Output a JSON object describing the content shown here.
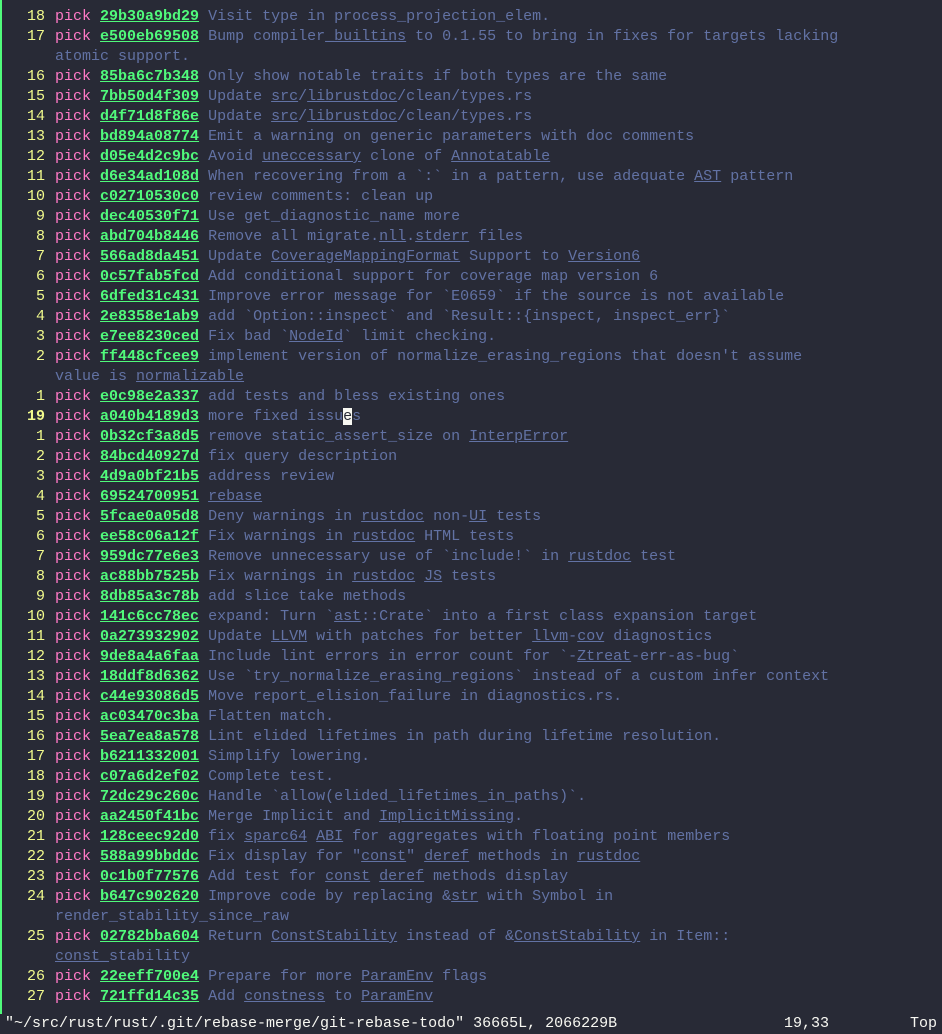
{
  "cursor_line_abs": "19",
  "lines": [
    {
      "ln": "18",
      "type": "commit",
      "hash": "29b30a9bd29",
      "msg_parts": [
        {
          "t": "Visit type in process_projection_elem."
        }
      ]
    },
    {
      "ln": "17",
      "type": "commit",
      "hash": "e500eb69508",
      "msg_parts": [
        {
          "t": "Bump compiler"
        },
        {
          "t": "_builtins",
          "u": 1
        },
        {
          "t": " to 0.1.55 to bring in fixes for targets lacking"
        }
      ]
    },
    {
      "ln": "",
      "type": "wrap",
      "msg_parts": [
        {
          "t": "atomic support."
        }
      ]
    },
    {
      "ln": "16",
      "type": "commit",
      "hash": "85ba6c7b348",
      "msg_parts": [
        {
          "t": "Only show notable traits if both types are the same"
        }
      ]
    },
    {
      "ln": "15",
      "type": "commit",
      "hash": "7bb50d4f309",
      "msg_parts": [
        {
          "t": "Update "
        },
        {
          "t": "src",
          "u": 1
        },
        {
          "t": "/"
        },
        {
          "t": "librustdoc",
          "u": 1
        },
        {
          "t": "/clean/types.rs"
        }
      ]
    },
    {
      "ln": "14",
      "type": "commit",
      "hash": "d4f71d8f86e",
      "msg_parts": [
        {
          "t": "Update "
        },
        {
          "t": "src",
          "u": 1
        },
        {
          "t": "/"
        },
        {
          "t": "librustdoc",
          "u": 1
        },
        {
          "t": "/clean/types.rs"
        }
      ]
    },
    {
      "ln": "13",
      "type": "commit",
      "hash": "bd894a08774",
      "msg_parts": [
        {
          "t": "Emit a warning on generic parameters with doc comments"
        }
      ]
    },
    {
      "ln": "12",
      "type": "commit",
      "hash": "d05e4d2c9bc",
      "msg_parts": [
        {
          "t": "Avoid "
        },
        {
          "t": "uneccessary",
          "u": 1
        },
        {
          "t": " clone of "
        },
        {
          "t": "Annotatable",
          "u": 1
        }
      ]
    },
    {
      "ln": "11",
      "type": "commit",
      "hash": "d6e34ad108d",
      "msg_parts": [
        {
          "t": "When recovering from a `:` in a pattern, use adequate "
        },
        {
          "t": "AST",
          "u": 1
        },
        {
          "t": " pattern"
        }
      ]
    },
    {
      "ln": "10",
      "type": "commit",
      "hash": "c02710530c0",
      "msg_parts": [
        {
          "t": "review comments: clean up"
        }
      ]
    },
    {
      "ln": "9",
      "type": "commit",
      "hash": "dec40530f71",
      "msg_parts": [
        {
          "t": "Use get_diagnostic_name more"
        }
      ]
    },
    {
      "ln": "8",
      "type": "commit",
      "hash": "abd704b8446",
      "msg_parts": [
        {
          "t": "Remove all migrate."
        },
        {
          "t": "nll",
          "u": 1
        },
        {
          "t": "."
        },
        {
          "t": "stderr",
          "u": 1
        },
        {
          "t": " files"
        }
      ]
    },
    {
      "ln": "7",
      "type": "commit",
      "hash": "566ad8da451",
      "msg_parts": [
        {
          "t": "Update "
        },
        {
          "t": "CoverageMappingFormat",
          "u": 1
        },
        {
          "t": " Support to "
        },
        {
          "t": "Version6",
          "u": 1
        }
      ]
    },
    {
      "ln": "6",
      "type": "commit",
      "hash": "0c57fab5fcd",
      "msg_parts": [
        {
          "t": "Add conditional support for coverage map version 6"
        }
      ]
    },
    {
      "ln": "5",
      "type": "commit",
      "hash": "6dfed31c431",
      "msg_parts": [
        {
          "t": "Improve error message for `E0659` if the source is not available"
        }
      ]
    },
    {
      "ln": "4",
      "type": "commit",
      "hash": "2e8358e1ab9",
      "msg_parts": [
        {
          "t": "add `Option::inspect` and `Result::{inspect, inspect_err}`"
        }
      ]
    },
    {
      "ln": "3",
      "type": "commit",
      "hash": "e7ee8230ced",
      "msg_parts": [
        {
          "t": "Fix bad `"
        },
        {
          "t": "NodeId",
          "u": 1
        },
        {
          "t": "` limit checking."
        }
      ]
    },
    {
      "ln": "2",
      "type": "commit",
      "hash": "ff448cfcee9",
      "msg_parts": [
        {
          "t": "implement version of normalize_erasing_regions that doesn't assume"
        }
      ]
    },
    {
      "ln": "",
      "type": "wrap",
      "msg_parts": [
        {
          "t": "value is "
        },
        {
          "t": "normalizable",
          "u": 1
        }
      ]
    },
    {
      "ln": "1",
      "type": "commit",
      "hash": "e0c98e2a337",
      "msg_parts": [
        {
          "t": "add tests and bless existing ones"
        }
      ]
    },
    {
      "ln": "19",
      "type": "cursor",
      "hash": "a040b4189d3",
      "msg_pre": "more fixed issu",
      "cursor_char": "e",
      "msg_post": "s"
    },
    {
      "ln": "1",
      "type": "commit",
      "hash": "0b32cf3a8d5",
      "msg_parts": [
        {
          "t": "remove static_assert_size on "
        },
        {
          "t": "InterpError",
          "u": 1
        }
      ]
    },
    {
      "ln": "2",
      "type": "commit",
      "hash": "84bcd40927d",
      "msg_parts": [
        {
          "t": "fix query description"
        }
      ]
    },
    {
      "ln": "3",
      "type": "commit",
      "hash": "4d9a0bf21b5",
      "msg_parts": [
        {
          "t": "address review"
        }
      ]
    },
    {
      "ln": "4",
      "type": "commit",
      "hash": "69524700951",
      "msg_parts": [
        {
          "t": "rebase",
          "u": 1
        }
      ]
    },
    {
      "ln": "5",
      "type": "commit",
      "hash": "5fcae0a05d8",
      "msg_parts": [
        {
          "t": "Deny warnings in "
        },
        {
          "t": "rustdoc",
          "u": 1
        },
        {
          "t": " non-"
        },
        {
          "t": "UI",
          "u": 1
        },
        {
          "t": " tests"
        }
      ]
    },
    {
      "ln": "6",
      "type": "commit",
      "hash": "ee58c06a12f",
      "msg_parts": [
        {
          "t": "Fix warnings in "
        },
        {
          "t": "rustdoc",
          "u": 1
        },
        {
          "t": " HTML tests"
        }
      ]
    },
    {
      "ln": "7",
      "type": "commit",
      "hash": "959dc77e6e3",
      "msg_parts": [
        {
          "t": "Remove unnecessary use of `include!` in "
        },
        {
          "t": "rustdoc",
          "u": 1
        },
        {
          "t": " test"
        }
      ]
    },
    {
      "ln": "8",
      "type": "commit",
      "hash": "ac88bb7525b",
      "msg_parts": [
        {
          "t": "Fix warnings in "
        },
        {
          "t": "rustdoc",
          "u": 1
        },
        {
          "t": " "
        },
        {
          "t": "JS",
          "u": 1
        },
        {
          "t": " tests"
        }
      ]
    },
    {
      "ln": "9",
      "type": "commit",
      "hash": "8db85a3c78b",
      "msg_parts": [
        {
          "t": "add slice take methods"
        }
      ]
    },
    {
      "ln": "10",
      "type": "commit",
      "hash": "141c6cc78ec",
      "msg_parts": [
        {
          "t": "expand: Turn `"
        },
        {
          "t": "ast",
          "u": 1
        },
        {
          "t": "::Crate` into a first class expansion target"
        }
      ]
    },
    {
      "ln": "11",
      "type": "commit",
      "hash": "0a273932902",
      "msg_parts": [
        {
          "t": "Update "
        },
        {
          "t": "LLVM",
          "u": 1
        },
        {
          "t": " with patches for better "
        },
        {
          "t": "llvm",
          "u": 1
        },
        {
          "t": "-"
        },
        {
          "t": "cov",
          "u": 1
        },
        {
          "t": " diagnostics"
        }
      ]
    },
    {
      "ln": "12",
      "type": "commit",
      "hash": "9de8a4a6faa",
      "msg_parts": [
        {
          "t": "Include lint errors in error count for `-"
        },
        {
          "t": "Ztreat",
          "u": 1
        },
        {
          "t": "-err-as-bug`"
        }
      ]
    },
    {
      "ln": "13",
      "type": "commit",
      "hash": "18ddf8d6362",
      "msg_parts": [
        {
          "t": "Use `try_normalize_erasing_regions` instead of a custom infer context"
        }
      ]
    },
    {
      "ln": "14",
      "type": "commit",
      "hash": "c44e93086d5",
      "msg_parts": [
        {
          "t": "Move report_elision_failure in diagnostics.rs."
        }
      ]
    },
    {
      "ln": "15",
      "type": "commit",
      "hash": "ac03470c3ba",
      "msg_parts": [
        {
          "t": "Flatten match."
        }
      ]
    },
    {
      "ln": "16",
      "type": "commit",
      "hash": "5ea7ea8a578",
      "msg_parts": [
        {
          "t": "Lint elided lifetimes in path during lifetime resolution."
        }
      ]
    },
    {
      "ln": "17",
      "type": "commit",
      "hash": "b6211332001",
      "msg_parts": [
        {
          "t": "Simplify lowering."
        }
      ]
    },
    {
      "ln": "18",
      "type": "commit",
      "hash": "c07a6d2ef02",
      "msg_parts": [
        {
          "t": "Complete test."
        }
      ]
    },
    {
      "ln": "19",
      "type": "commit",
      "hash": "72dc29c260c",
      "msg_parts": [
        {
          "t": "Handle `allow(elided_lifetimes_in_paths)`."
        }
      ]
    },
    {
      "ln": "20",
      "type": "commit",
      "hash": "aa2450f41bc",
      "msg_parts": [
        {
          "t": "Merge Implicit and "
        },
        {
          "t": "ImplicitMissing",
          "u": 1
        },
        {
          "t": "."
        }
      ]
    },
    {
      "ln": "21",
      "type": "commit",
      "hash": "128ceec92d0",
      "msg_parts": [
        {
          "t": "fix "
        },
        {
          "t": "sparc64",
          "u": 1
        },
        {
          "t": " "
        },
        {
          "t": "ABI",
          "u": 1
        },
        {
          "t": " for aggregates with floating point members"
        }
      ]
    },
    {
      "ln": "22",
      "type": "commit",
      "hash": "588a99bbddc",
      "msg_parts": [
        {
          "t": "Fix display for \""
        },
        {
          "t": "const",
          "u": 1
        },
        {
          "t": "\" "
        },
        {
          "t": "deref",
          "u": 1
        },
        {
          "t": " methods in "
        },
        {
          "t": "rustdoc",
          "u": 1
        }
      ]
    },
    {
      "ln": "23",
      "type": "commit",
      "hash": "0c1b0f77576",
      "msg_parts": [
        {
          "t": "Add test for "
        },
        {
          "t": "const",
          "u": 1
        },
        {
          "t": " "
        },
        {
          "t": "deref",
          "u": 1
        },
        {
          "t": " methods display"
        }
      ]
    },
    {
      "ln": "24",
      "type": "commit",
      "hash": "b647c902620",
      "msg_parts": [
        {
          "t": "Improve code by replacing &"
        },
        {
          "t": "str",
          "u": 1
        },
        {
          "t": " with Symbol in"
        }
      ]
    },
    {
      "ln": "",
      "type": "wrap",
      "msg_parts": [
        {
          "t": "render_stability_since_raw"
        }
      ]
    },
    {
      "ln": "25",
      "type": "commit",
      "hash": "02782bba604",
      "msg_parts": [
        {
          "t": "Return "
        },
        {
          "t": "ConstStability",
          "u": 1
        },
        {
          "t": " instead of &"
        },
        {
          "t": "ConstStability",
          "u": 1
        },
        {
          "t": " in Item::"
        }
      ]
    },
    {
      "ln": "",
      "type": "wrap",
      "msg_parts": [
        {
          "t": "const_",
          "u": 1
        },
        {
          "t": "stability"
        }
      ]
    },
    {
      "ln": "26",
      "type": "commit",
      "hash": "22eeff700e4",
      "msg_parts": [
        {
          "t": "Prepare for more "
        },
        {
          "t": "ParamEnv",
          "u": 1
        },
        {
          "t": " flags"
        }
      ]
    },
    {
      "ln": "27",
      "type": "commit",
      "hash": "721ffd14c35",
      "msg_parts": [
        {
          "t": "Add "
        },
        {
          "t": "constness",
          "u": 1
        },
        {
          "t": " to "
        },
        {
          "t": "ParamEnv",
          "u": 1
        }
      ]
    }
  ],
  "pick_label": "pick",
  "status": {
    "filename": "\"~/src/rust/rust/.git/rebase-merge/git-rebase-todo\"",
    "fileinfo": "36665L, 2066229B",
    "pos": "19,33",
    "scroll": "Top"
  }
}
